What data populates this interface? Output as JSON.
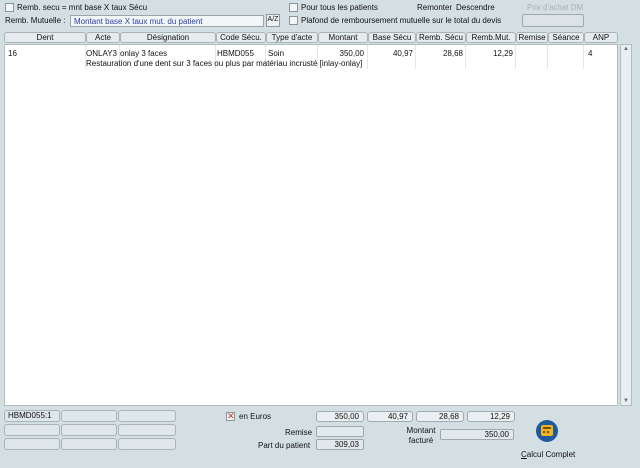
{
  "toolbar": {
    "remb_secu_label": "Remb. secu = mnt base X taux Sécu",
    "remb_mutuelle_label": "Remb. Mutuelle :",
    "remb_mutuelle_value": "Montant base X taux mut. du patient",
    "sort_button_label": "A/Z",
    "pour_tous_label": "Pour tous les patients",
    "plafond_label": "Plafond de remboursement mutuelle sur le total du devis",
    "remonter_label": "Remonter",
    "descendre_label": "Descendre",
    "prix_achat_label": "Prix d'achat DM"
  },
  "table": {
    "headers": [
      "Dent",
      "Acte",
      "Désignation",
      "Code Sécu.",
      "Type d'acte",
      "Montant",
      "Base Sécu",
      "Remb. Sécu",
      "Remb.Mut.",
      "Remise",
      "Séance",
      "ANP"
    ],
    "rows": [
      {
        "dent": "16",
        "acte": "ONLAY3",
        "designation": "onlay 3 faces",
        "code_secu": "HBMD055",
        "type_acte": "Soin",
        "montant": "350,00",
        "base_secu": "40,97",
        "remb_secu": "28,68",
        "remb_mut": "12,29",
        "remise": "",
        "seance": "",
        "anp": "4",
        "description": "Restauration d'une dent sur 3 faces ou plus par matériau incrusté [inlay-onlay]"
      }
    ]
  },
  "footer": {
    "code_field": "HBMD055:1",
    "en_euros_label": "en Euros",
    "total_montant": "350,00",
    "total_base_secu": "40,97",
    "total_remb_secu": "28,68",
    "total_remb_mut": "12,29",
    "remise_label": "Remise",
    "part_patient_label": "Part du patient",
    "part_patient_value": "309,03",
    "montant_facture_label_1": "Montant",
    "montant_facture_label_2": "facturé",
    "montant_facture_value": "350,00",
    "calcul_button_label": "Calcul Complet",
    "calcul_button_hotkey": "C",
    "calcul_button_rest": "alcul Complet"
  },
  "colors": {
    "background": "#d4dfe3",
    "combo_text": "#2a3fa0",
    "calc_icon": "#f2b41e"
  }
}
